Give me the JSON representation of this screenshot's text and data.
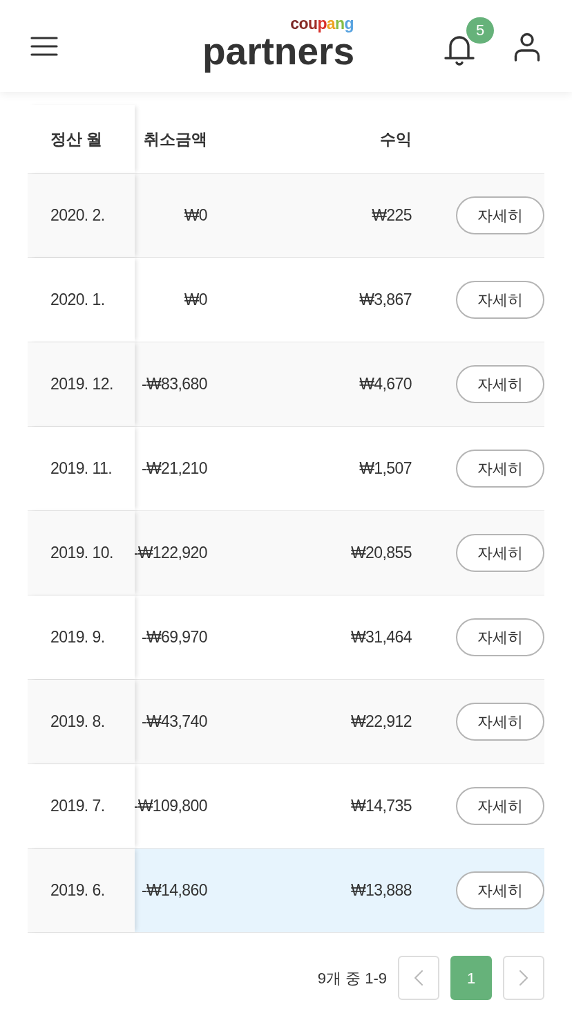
{
  "header": {
    "logo": {
      "brand": "coupang",
      "product": "partners"
    },
    "notification_count": "5"
  },
  "table": {
    "columns": [
      "정산 월",
      "취소금액",
      "수익"
    ],
    "rows": [
      {
        "month": "2020. 2.",
        "cancel_amount": "₩0",
        "revenue": "₩225",
        "action": "자세히",
        "highlighted": false
      },
      {
        "month": "2020. 1.",
        "cancel_amount": "₩0",
        "revenue": "₩3,867",
        "action": "자세히",
        "highlighted": false
      },
      {
        "month": "2019. 12.",
        "cancel_amount": "-₩83,680",
        "revenue": "₩4,670",
        "action": "자세히",
        "highlighted": false
      },
      {
        "month": "2019. 11.",
        "cancel_amount": "-₩21,210",
        "revenue": "₩1,507",
        "action": "자세히",
        "highlighted": false
      },
      {
        "month": "2019. 10.",
        "cancel_amount": "-₩122,920",
        "revenue": "₩20,855",
        "action": "자세히",
        "highlighted": false
      },
      {
        "month": "2019. 9.",
        "cancel_amount": "-₩69,970",
        "revenue": "₩31,464",
        "action": "자세히",
        "highlighted": false
      },
      {
        "month": "2019. 8.",
        "cancel_amount": "-₩43,740",
        "revenue": "₩22,912",
        "action": "자세히",
        "highlighted": false
      },
      {
        "month": "2019. 7.",
        "cancel_amount": "-₩109,800",
        "revenue": "₩14,735",
        "action": "자세히",
        "highlighted": false
      },
      {
        "month": "2019. 6.",
        "cancel_amount": "-₩14,860",
        "revenue": "₩13,888",
        "action": "자세히",
        "highlighted": true
      }
    ]
  },
  "pagination": {
    "summary": "9개 중 1-9",
    "pages": [
      {
        "label": "1",
        "selected": true
      }
    ]
  }
}
